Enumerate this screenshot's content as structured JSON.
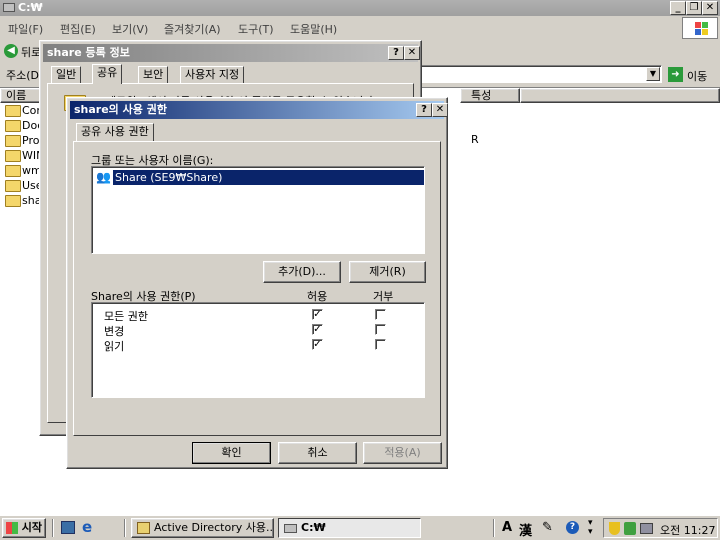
{
  "explorer": {
    "title": "C:₩",
    "menu": [
      "파일(F)",
      "편집(E)",
      "보기(V)",
      "즐겨찾기(A)",
      "도구(T)",
      "도움말(H)"
    ],
    "back_label": "뒤로",
    "address_label": "주소(D)",
    "go_label": "이동",
    "col_name": "이름",
    "col_attr": "특성",
    "items": [
      "Con",
      "Doc",
      "Pro",
      "WIN",
      "wm",
      "Use",
      "sha"
    ],
    "attr_value": "R"
  },
  "props": {
    "title": "share 등록 정보",
    "tabs": [
      "일반",
      "공유",
      "보안",
      "사용자 지정"
    ],
    "desc": "네트워크에서 다른 사용자와 이 폴더를 공유할 수 있습니다."
  },
  "perm": {
    "title": "share의 사용 권한",
    "tab": "공유 사용 권한",
    "group_label": "그룹 또는 사용자 이름(G):",
    "users": [
      "Share (SE9₩Share)"
    ],
    "add_button": "추가(D)...",
    "remove_button": "제거(R)",
    "perm_label": "Share의 사용 권한(P)",
    "allow_header": "허용",
    "deny_header": "거부",
    "permissions": [
      {
        "name": "모든 권한",
        "allow": true,
        "deny": false
      },
      {
        "name": "변경",
        "allow": true,
        "deny": false
      },
      {
        "name": "읽기",
        "allow": true,
        "deny": false
      }
    ],
    "ok_button": "확인",
    "cancel_button": "취소",
    "apply_button": "적용(A)"
  },
  "taskbar": {
    "start_label": "시작",
    "tasks": [
      "Active Directory 사용...",
      "C:₩"
    ],
    "ime": [
      "A",
      "漢"
    ],
    "clock": "오전 11:27"
  },
  "colors": {
    "titlebar": "#0a246a",
    "selection": "#0a246a",
    "desktop": "#d4d0c8"
  }
}
